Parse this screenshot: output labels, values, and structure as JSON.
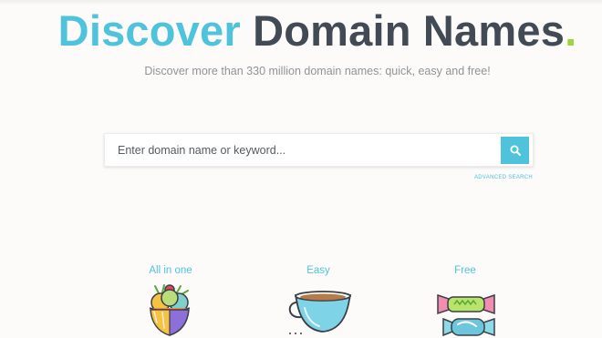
{
  "hero": {
    "title_accent": "Discover",
    "title_main": " Domain Names",
    "title_dot": ".",
    "subtitle": "Discover more than 330 million domain names: quick, easy and free!"
  },
  "search": {
    "placeholder": "Enter domain name or keyword...",
    "value": "",
    "button_icon": "search-icon",
    "advanced_link": "ADVANCED SEARCH"
  },
  "features": [
    {
      "label": "All in one",
      "icon": "ice-cream-sundae-icon"
    },
    {
      "label": "Easy",
      "icon": "coffee-cup-icon"
    },
    {
      "label": "Free",
      "icon": "candy-icon"
    }
  ],
  "colors": {
    "accent": "#4fc3dc",
    "title_dark": "#424a55",
    "dot_green": "#9ed43f",
    "subtitle": "#8f9398",
    "background": "#fcfbfa"
  }
}
